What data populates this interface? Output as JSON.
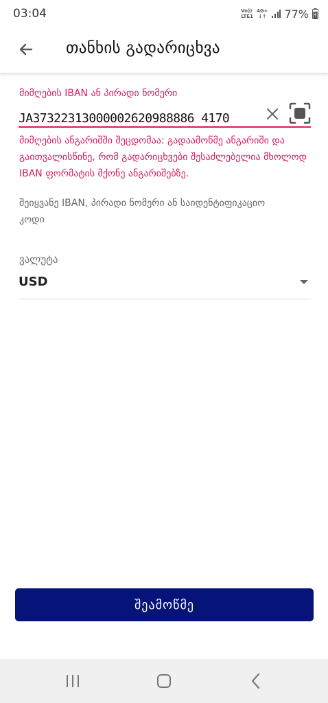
{
  "status_bar": {
    "time": "03:04",
    "volte_top": "Vo))",
    "volte_bottom": "LTE1",
    "network_type": "4G+",
    "network_arrows": "↓↑",
    "battery": "77%"
  },
  "header": {
    "title": "თანხის გადარიცხვა",
    "back_icon": "arrow-left-icon"
  },
  "recipient_field": {
    "label": "მიმღების IBAN ან პირადი ნომერი",
    "value": "JA37322313000002620988886 4170",
    "error": "მიმღების ანგარიშში შეცდომაა: გადაამოწმე ანგარიში და გაითვალისწინე, რომ გადარიცხვები შესაძლებელია მხოლოდ IBAN ფორმატის მქონე ანგარიშებზე.",
    "helper": "შეიყვანე IBAN, პირადი ნომერი ან საიდენტიფიკაციო კოდი",
    "clear_icon": "close-icon",
    "scan_icon": "scan-icon",
    "error_color": "#d81b60"
  },
  "currency": {
    "label": "ვალუტა",
    "value": "USD",
    "dropdown_icon": "dropdown-arrow-icon"
  },
  "actions": {
    "check_label": "შეამოწმე",
    "button_color": "#061379"
  },
  "nav_bar": {
    "recents_icon": "recents-icon",
    "home_icon": "home-icon",
    "back_icon": "nav-back-icon"
  }
}
